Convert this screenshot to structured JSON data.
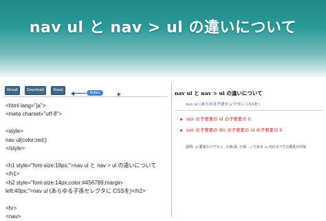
{
  "banner": {
    "title": "nav ul と nav > ul の違いについて"
  },
  "toolbar": {
    "result_label": "Result",
    "download_label": "Download",
    "reset_label": "Reset",
    "button_hint": "Button"
  },
  "code_lines": [
    "<html lang=\"ja\">",
    "<meta charset=\"utf-8\">",
    "",
    "<style>",
    "nav ul{color:red;}",
    "</style>",
    "",
    "<h1 style=\"font-size:18px;\">nav ul と nav > ul の違いについて",
    "</h1>",
    "<h2 style=\"font-size:14px;color:#456789;margin-",
    "left:40px;\">nav ul (あらゆる子孫セレクタに CSSを)</h2>",
    "",
    "<hr>",
    "<nav>"
  ],
  "preview": {
    "h1": "nav ul と nav > ul の違いについて",
    "h2": "nav ul (あらゆる子孫セレクタに CSSを)",
    "items": [
      "nav の子要素の ul の子要素の li",
      "nav の子要素の div の子要素の ul の子要素の li"
    ],
    "note": "説明: ul 要素だけでなく, 子孫(孫, ひ孫....) である ul 内のすべての要素が対象"
  },
  "colors": {
    "banner_top": "#1f8a8a",
    "button": "#3f6788",
    "h2_color": "#456789",
    "list_red": "#e0201f"
  }
}
